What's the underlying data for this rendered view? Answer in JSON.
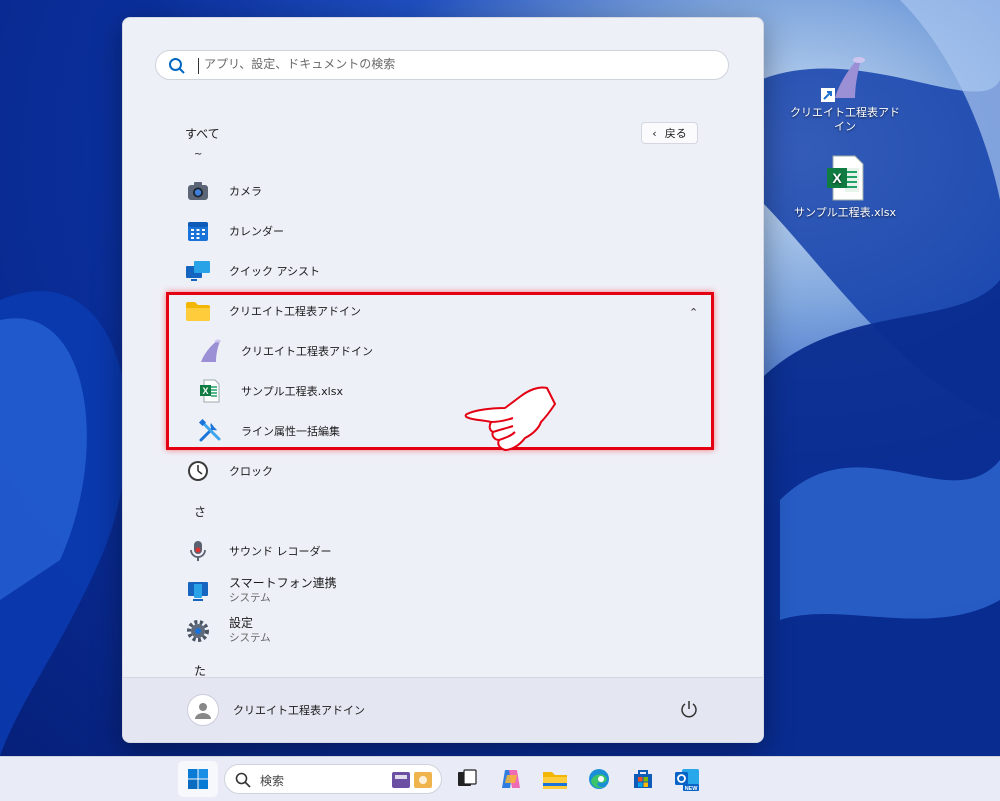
{
  "desktop": {
    "icons": [
      {
        "label": "クリエイト工程表アドイン"
      },
      {
        "label": "サンプル工程表.xlsx"
      }
    ]
  },
  "start_menu": {
    "search": {
      "placeholder": "アプリ、設定、ドキュメントの検索"
    },
    "header": {
      "title": "すべて",
      "back_label": "戻る"
    },
    "list": {
      "tilde": "~",
      "camera": "カメラ",
      "calendar": "カレンダー",
      "quick_assist": "クイック アシスト",
      "folder": "クリエイト工程表アドイン",
      "folder_items": [
        "クリエイト工程表アドイン",
        "サンプル工程表.xlsx",
        "ライン属性一括編集"
      ],
      "clock": "クロック",
      "letter_sa": "さ",
      "sound_recorder": "サウンド レコーダー",
      "phone_link": {
        "title": "スマートフォン連携",
        "sub": "システム"
      },
      "settings": {
        "title": "設定",
        "sub": "システム"
      },
      "letter_ta": "た"
    },
    "footer": {
      "user_name": "クリエイト工程表アドイン"
    }
  },
  "taskbar": {
    "search_label": "検索"
  },
  "colors": {
    "highlight": "#e30012",
    "accent": "#0067c0"
  }
}
